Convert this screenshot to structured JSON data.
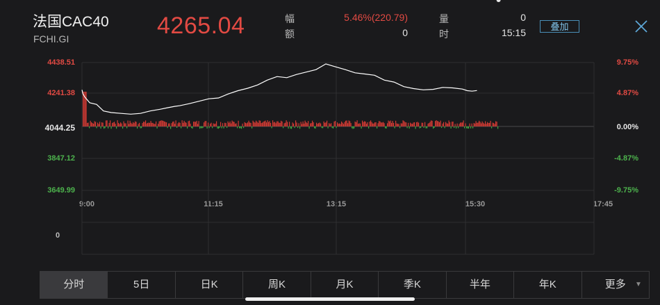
{
  "header": {
    "name": "法国CAC40",
    "code": "FCHI.GI",
    "price": "4265.04",
    "fu_label": "幅",
    "fu_value": "5.46%(220.79)",
    "e_label": "额",
    "e_value": "0",
    "liang_label": "量",
    "liang_value": "0",
    "shi_label": "时",
    "shi_value": "15:15",
    "overlay_button": "叠加",
    "close_icon": "close-x-icon"
  },
  "chart_data": {
    "type": "line",
    "y_left_ticks": [
      "4438.51",
      "4241.38",
      "4044.25",
      "3847.12",
      "3649.99"
    ],
    "y_right_ticks": [
      "9.75%",
      "4.87%",
      "0.00%",
      "-4.87%",
      "-9.75%"
    ],
    "x_ticks": [
      "9:00",
      "11:15",
      "13:15",
      "15:30",
      "17:45"
    ],
    "ylim": [
      3649.99,
      4438.51
    ],
    "xlim_minutes": [
      0,
      525
    ],
    "base": 4044.25,
    "series": [
      {
        "color": "#ffffff",
        "x_minutes": [
          0,
          1,
          3,
          8,
          15,
          22,
          30,
          40,
          50,
          60,
          70,
          80,
          88,
          95,
          100,
          110,
          120,
          130,
          140,
          150,
          160,
          170,
          180,
          190,
          200,
          210,
          220,
          230,
          240,
          250,
          260,
          270,
          280,
          290,
          300,
          310,
          320,
          330,
          340,
          350,
          360,
          370,
          380,
          390,
          395,
          400,
          405,
          410,
          415,
          420,
          425
        ],
        "values": [
          4270,
          4245,
          4225,
          4190,
          4180,
          4140,
          4130,
          4125,
          4120,
          4125,
          4140,
          4150,
          4160,
          4168,
          4172,
          4185,
          4200,
          4215,
          4220,
          4245,
          4265,
          4280,
          4300,
          4330,
          4352,
          4345,
          4365,
          4380,
          4395,
          4430,
          4412,
          4395,
          4375,
          4368,
          4360,
          4330,
          4318,
          4290,
          4278,
          4270,
          4273,
          4285,
          4282,
          4275,
          4265,
          4262,
          4266
        ]
      }
    ],
    "histogram": {
      "note": "deviation bars from 0.00% base",
      "up_color": "#d23a33",
      "down_color": "#3faa3f"
    },
    "volume_label": "0"
  },
  "tabs": [
    {
      "label": "分时",
      "active": true
    },
    {
      "label": "5日"
    },
    {
      "label": "日K"
    },
    {
      "label": "周K"
    },
    {
      "label": "月K"
    },
    {
      "label": "季K"
    },
    {
      "label": "半年"
    },
    {
      "label": "年K"
    },
    {
      "label": "更多",
      "has_caret": true
    }
  ]
}
